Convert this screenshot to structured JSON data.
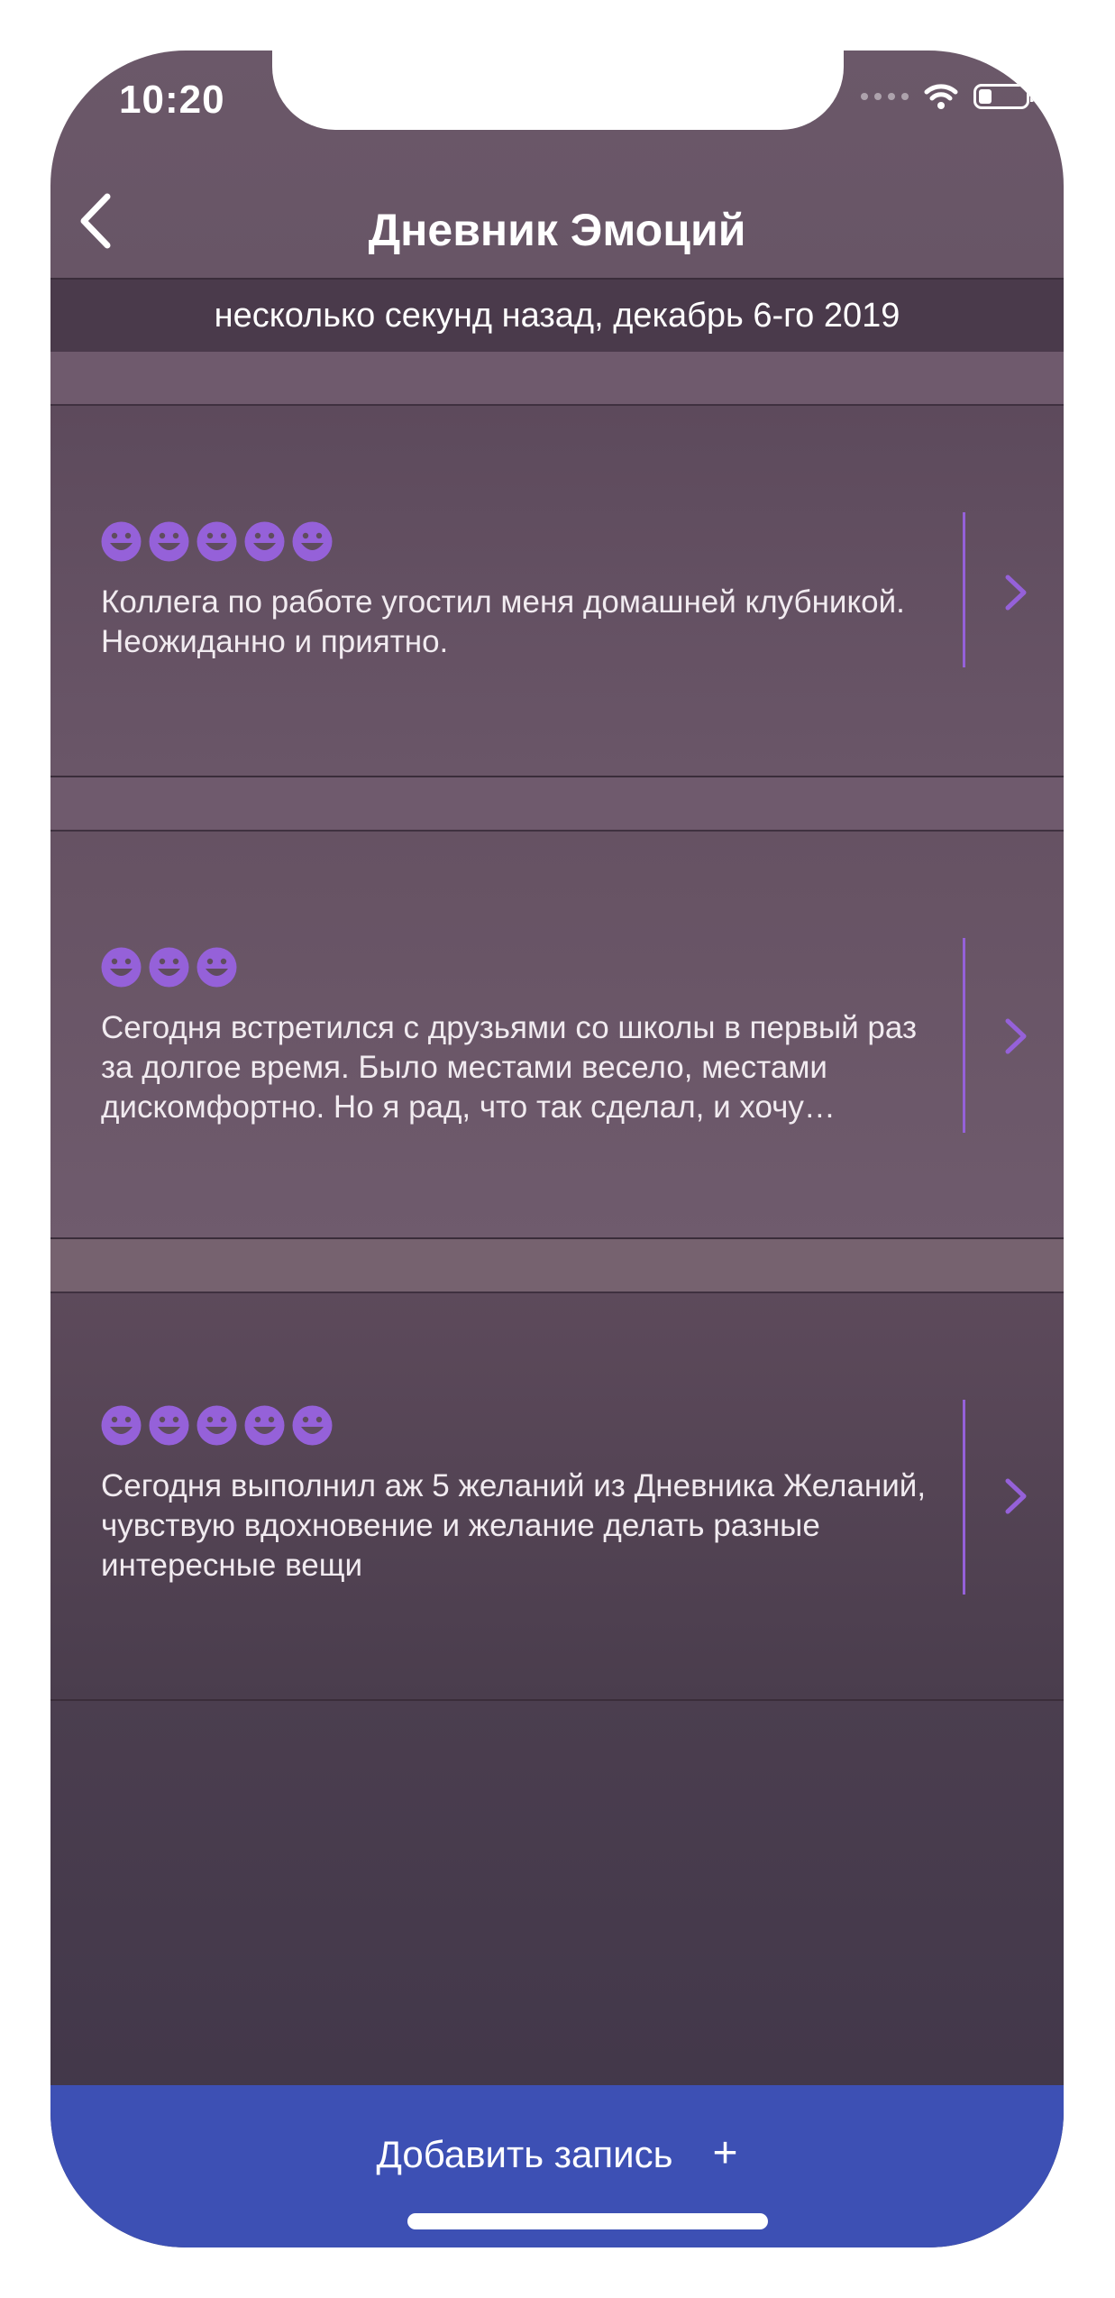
{
  "status_bar": {
    "time": "10:20"
  },
  "navbar": {
    "title": "Дневник Эмоций"
  },
  "date_header": "несколько секунд назад, декабрь 6-го 2019",
  "colors": {
    "accent": "#9561d9",
    "button": "#3d50b4",
    "background": "#5f4c5e"
  },
  "entries": [
    {
      "rating": 5,
      "text": "Коллега по работе угостил меня домашней клубникой. Неожиданно и приятно."
    },
    {
      "rating": 3,
      "text": "Сегодня встретился с друзьями со школы в первый раз за долгое время. Было местами весело, местами дискомфортно. Но я рад, что так сделал, и хочу повторить."
    },
    {
      "rating": 5,
      "text": "Сегодня выполнил аж 5 желаний из Дневника Желаний, чувствую вдохновение и желание делать разные интересные вещи"
    }
  ],
  "add_button": {
    "label": "Добавить запись",
    "icon": "plus-icon"
  }
}
